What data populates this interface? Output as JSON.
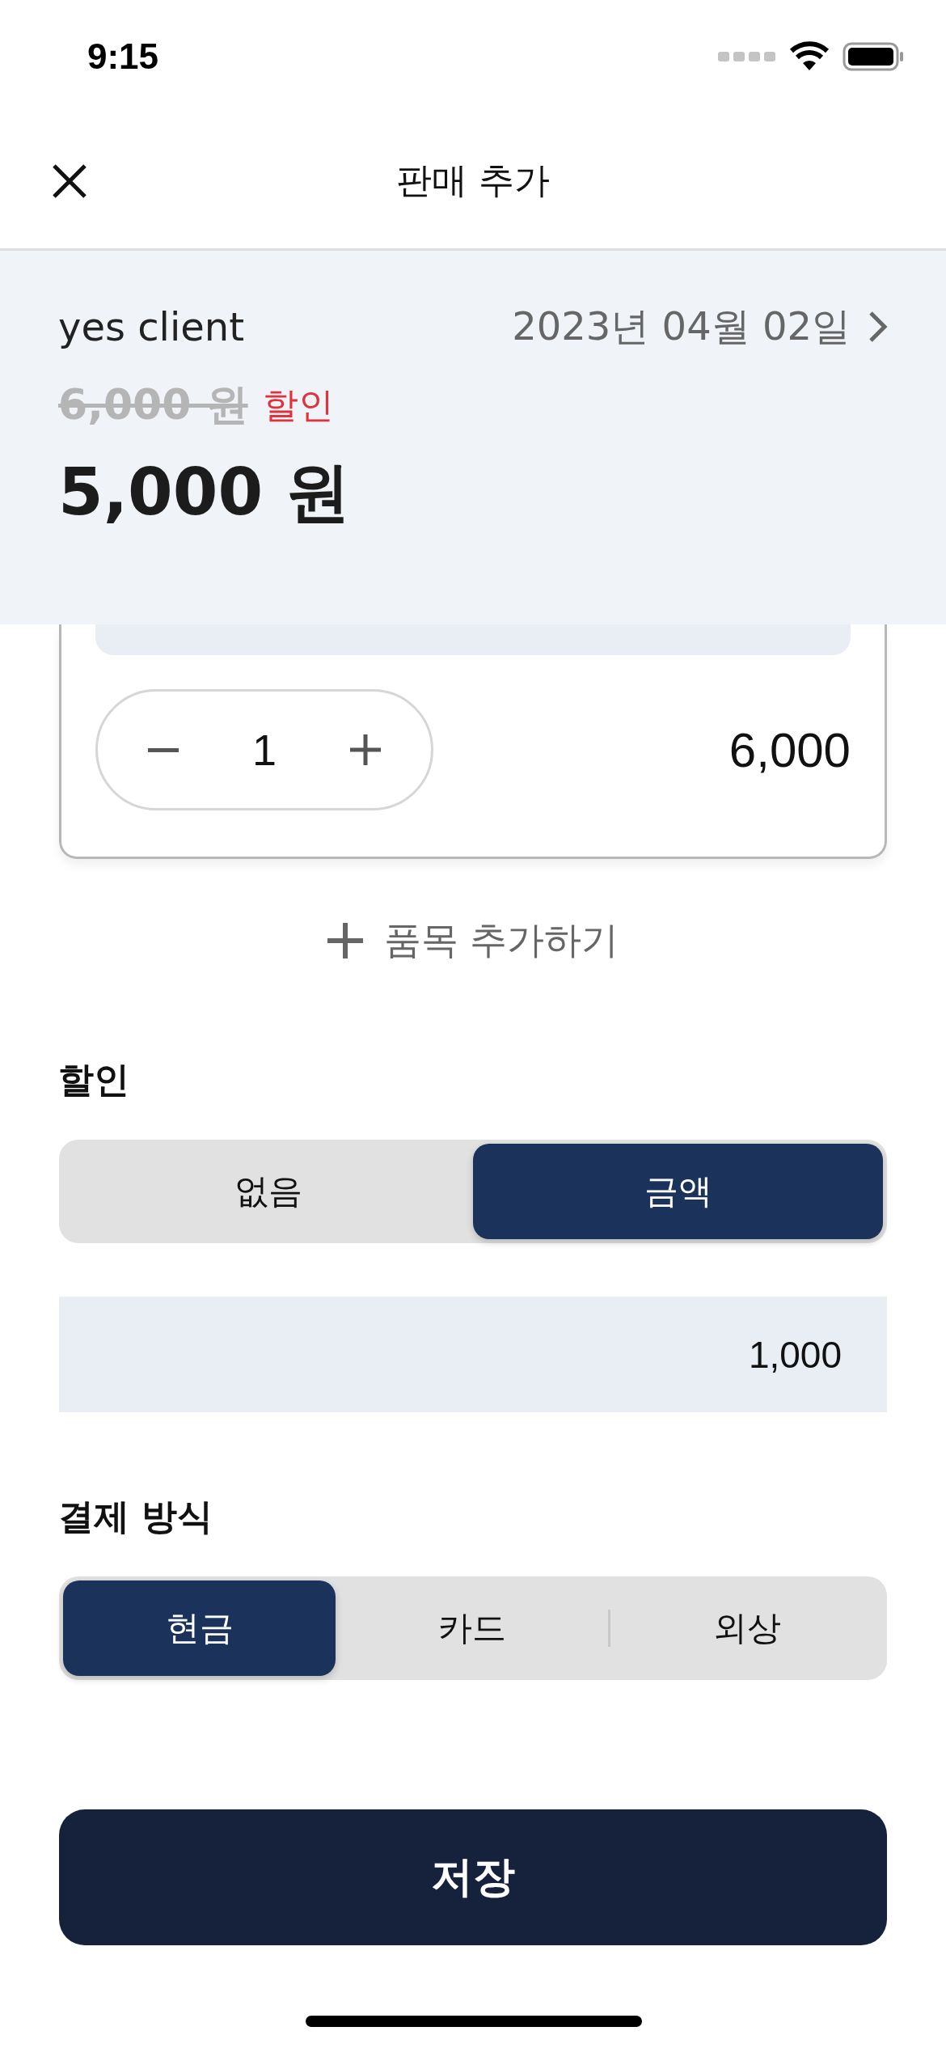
{
  "status_bar": {
    "time": "9:15"
  },
  "header": {
    "title": "판매 추가"
  },
  "summary": {
    "client": "yes client",
    "date": "2023년 04월 02일",
    "original_price": "6,000 원",
    "discount_tag": "할인",
    "total": "5,000 원"
  },
  "item": {
    "quantity": "1",
    "price": "6,000"
  },
  "add_item": {
    "label": "품목 추가하기"
  },
  "discount": {
    "label": "할인",
    "options": [
      {
        "label": "없음",
        "selected": false
      },
      {
        "label": "금액",
        "selected": true
      }
    ],
    "amount": "1,000"
  },
  "payment": {
    "label": "결제 방식",
    "options": [
      {
        "label": "현금",
        "selected": true
      },
      {
        "label": "카드",
        "selected": false
      },
      {
        "label": "외상",
        "selected": false
      }
    ]
  },
  "save_button": {
    "label": "저장"
  }
}
